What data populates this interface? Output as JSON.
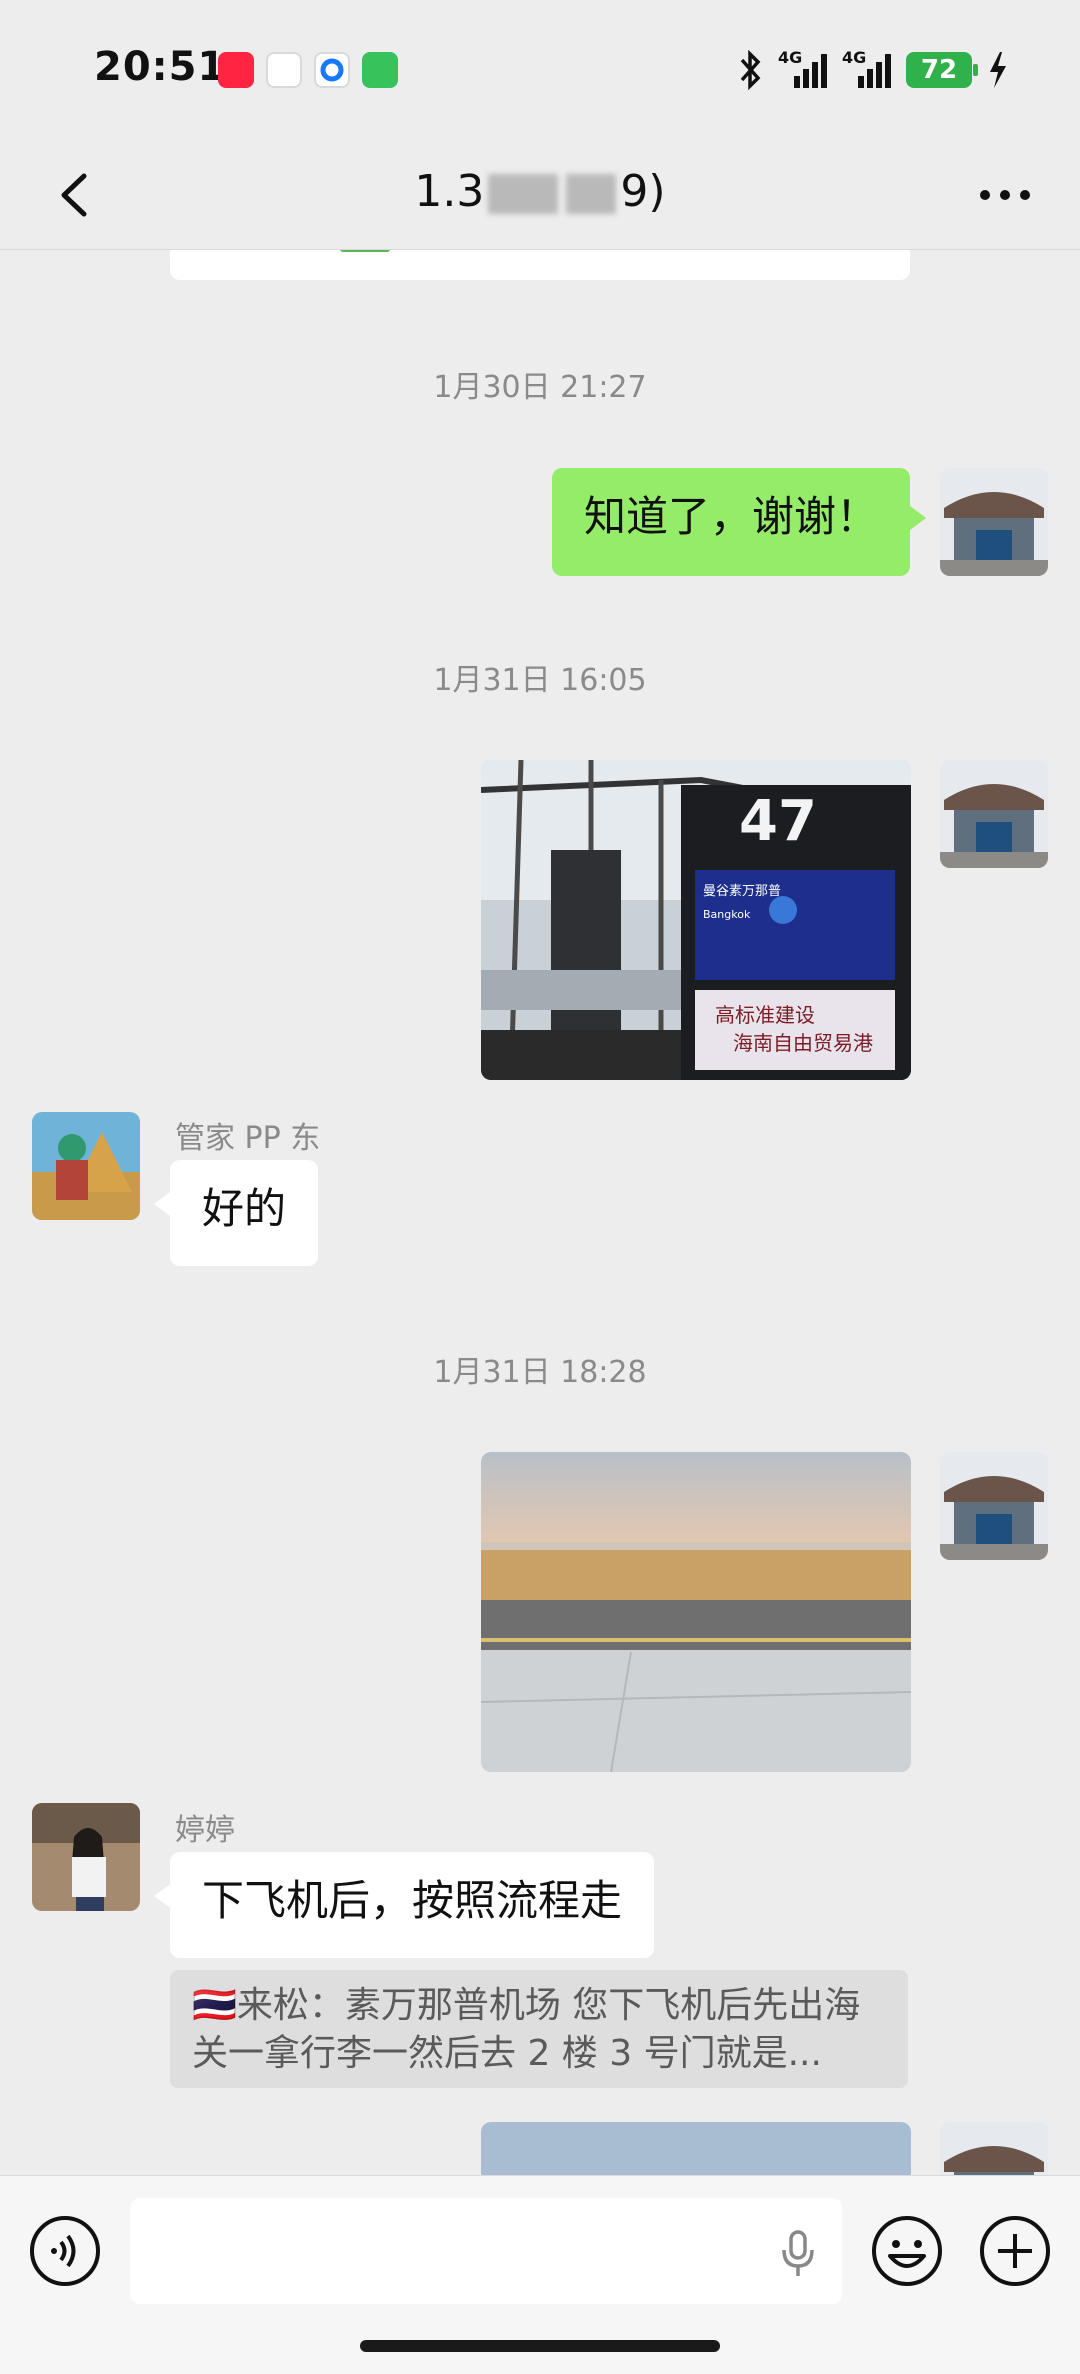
{
  "status_bar": {
    "time": "20:51",
    "battery": "72",
    "network_1": "4G",
    "network_2": "4G"
  },
  "nav": {
    "title_prefix": "1.3",
    "title_suffix": "9)"
  },
  "messages": {
    "ts1": "1月30日 21:27",
    "m1_text": "知道了，谢谢！",
    "ts2": "1月31日 16:05",
    "m2_sign_gate": "47",
    "m2_sign_city": "曼谷素万那普",
    "m2_sign_city_en": "Bangkok",
    "m2_banner": "高标准建设\n海南自由贸易港",
    "m3_sender": "管家 PP 东",
    "m3_text": "好的",
    "ts3": "1月31日 18:28",
    "m5_sender": "婷婷",
    "m5_text": "下飞机后，按照流程走",
    "m5_quote": "🇹🇭来松：素万那普机场 您下飞机后先出海关一拿行李一然后去 2 楼 3 号门就是..."
  },
  "colors": {
    "outgoing_bubble": "#95ec69",
    "background": "#ededed"
  }
}
